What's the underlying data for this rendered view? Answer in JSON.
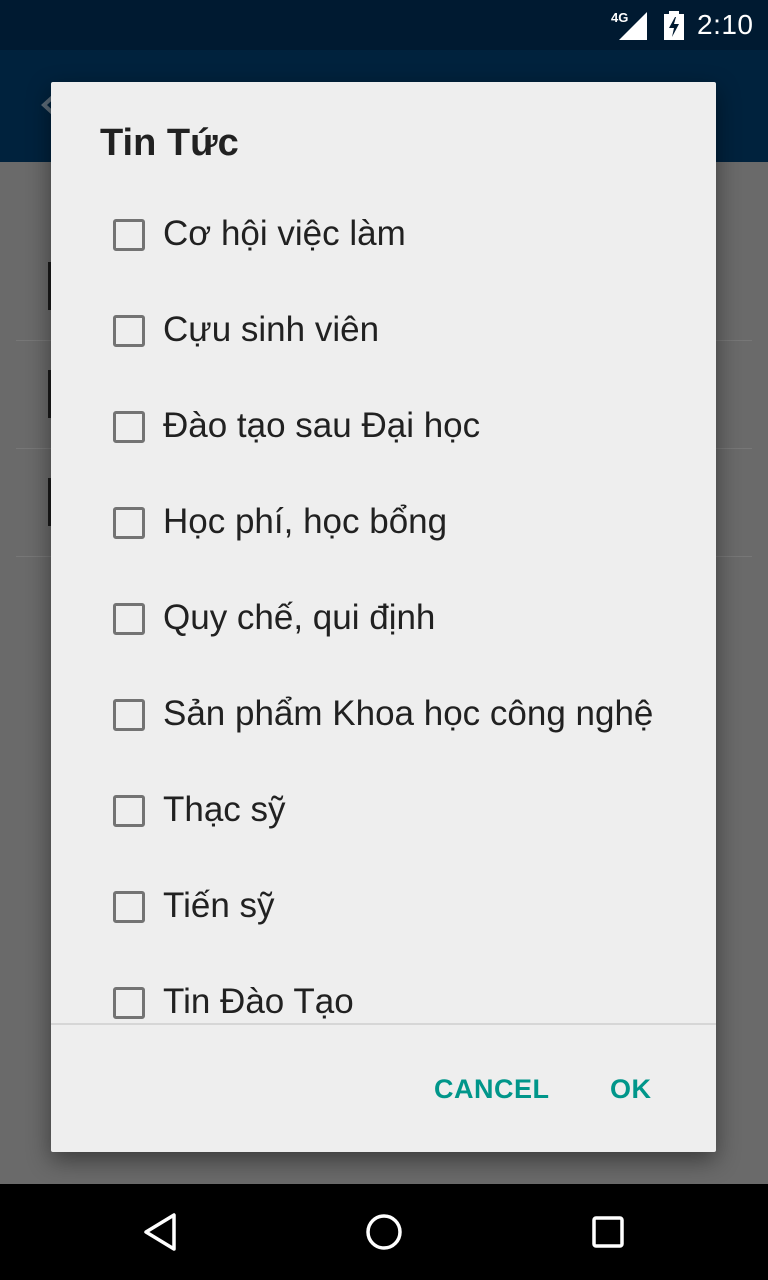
{
  "status_bar": {
    "network": "4G",
    "time": "2:10"
  },
  "dialog": {
    "title": "Tin Tức",
    "options": [
      {
        "label": "Cơ hội việc làm",
        "checked": false
      },
      {
        "label": "Cựu sinh viên",
        "checked": false
      },
      {
        "label": "Đào tạo sau Đại học",
        "checked": false
      },
      {
        "label": "Học phí, học bổng",
        "checked": false
      },
      {
        "label": "Quy chế, qui định",
        "checked": false
      },
      {
        "label": "Sản phẩm Khoa học công nghệ",
        "checked": false
      },
      {
        "label": "Thạc sỹ",
        "checked": false
      },
      {
        "label": "Tiến sỹ",
        "checked": false
      },
      {
        "label": "Tin Đào Tạo",
        "checked": false
      }
    ],
    "cancel_label": "CANCEL",
    "ok_label": "OK"
  },
  "colors": {
    "accent": "#00968a",
    "toolbar": "#00223d",
    "status_bar": "#001a31"
  }
}
